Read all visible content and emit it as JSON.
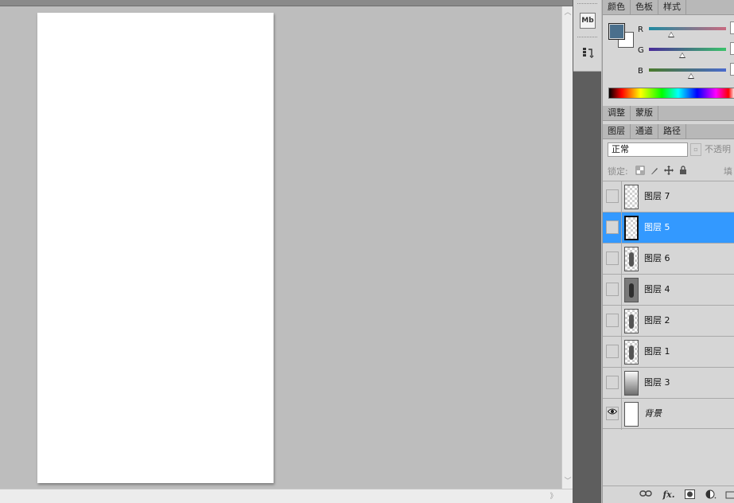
{
  "canvas": {
    "document_color": "#ffffff",
    "workspace_color": "#bdbdbd"
  },
  "dock": {
    "items": [
      {
        "icon": "mini-bridge-icon",
        "label": "Mb"
      },
      {
        "icon": "history-icon",
        "label": ""
      }
    ]
  },
  "color_panel": {
    "tabs": [
      "颜色",
      "色板",
      "样式"
    ],
    "active_tab": 0,
    "foreground_color": "#4a6f8c",
    "background_color": "#ffffff",
    "sliders": [
      {
        "label": "R",
        "value": 0.29,
        "track": "linear-gradient(to right,#1f8aa0,#c86a80)"
      },
      {
        "label": "G",
        "value": 0.43,
        "track": "linear-gradient(to right,#4a2a9a,#3bc36a)"
      },
      {
        "label": "B",
        "value": 0.55,
        "track": "linear-gradient(to right,#4a7a2a,#4a6acd)"
      }
    ]
  },
  "adjust_panel": {
    "tabs": [
      "调整",
      "蒙版"
    ],
    "active_tab": 0
  },
  "layers_panel": {
    "tabs": [
      "图层",
      "通道",
      "路径"
    ],
    "active_tab": 0,
    "blend_mode": "正常",
    "opacity_label": "不透明",
    "lock_label": "锁定:",
    "fill_label": "填",
    "layers": [
      {
        "name": "图层 7",
        "visible": false,
        "selected": false,
        "thumb": "checker"
      },
      {
        "name": "图层 5",
        "visible": false,
        "selected": true,
        "thumb": "checker"
      },
      {
        "name": "图层 6",
        "visible": false,
        "selected": false,
        "thumb": "figure"
      },
      {
        "name": "图层 4",
        "visible": false,
        "selected": false,
        "thumb": "dark"
      },
      {
        "name": "图层 2",
        "visible": false,
        "selected": false,
        "thumb": "figure"
      },
      {
        "name": "图层 1",
        "visible": false,
        "selected": false,
        "thumb": "figure"
      },
      {
        "name": "图层 3",
        "visible": false,
        "selected": false,
        "thumb": "grad"
      },
      {
        "name": "背景",
        "visible": true,
        "selected": false,
        "thumb": "white",
        "italic": true
      }
    ],
    "bottom_icons": [
      "link-layers-icon",
      "fx-icon",
      "add-mask-icon",
      "adjustment-layer-icon",
      "new-group-icon"
    ],
    "fx_label": "fx."
  }
}
